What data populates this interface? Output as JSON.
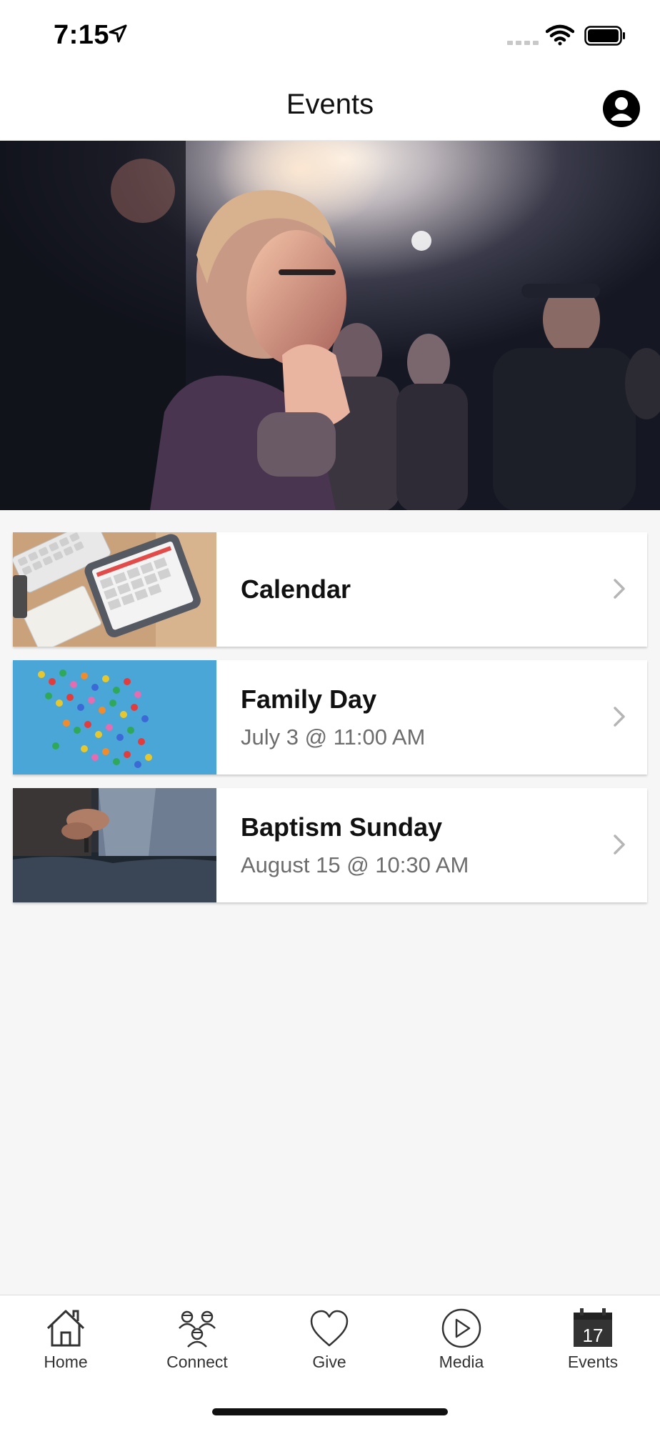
{
  "status": {
    "time": "7:15"
  },
  "nav": {
    "title": "Events"
  },
  "events": [
    {
      "title": "Calendar",
      "date": ""
    },
    {
      "title": "Family Day",
      "date": "July 3 @ 11:00 AM"
    },
    {
      "title": "Baptism Sunday",
      "date": "August 15 @ 10:30 AM"
    }
  ],
  "tabs": [
    {
      "label": "Home",
      "icon": "home-icon"
    },
    {
      "label": "Connect",
      "icon": "people-icon"
    },
    {
      "label": "Give",
      "icon": "heart-icon"
    },
    {
      "label": "Media",
      "icon": "play-icon"
    },
    {
      "label": "Events",
      "icon": "calendar-icon",
      "active": true,
      "calendar_day": "17"
    }
  ]
}
